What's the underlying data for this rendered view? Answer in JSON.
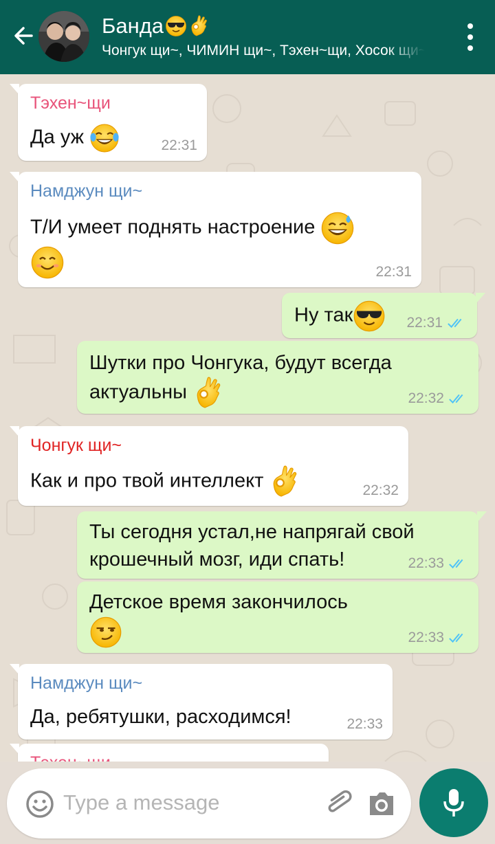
{
  "header": {
    "title": "Банда",
    "subtitle": "Чонгук щи~, ЧИМИН щи~, Тэхен~щи, Хосок щи~, Намджун щи~",
    "bg_color": "#075e54"
  },
  "messages": [
    {
      "id": "m1",
      "direction": "in",
      "sender": "Тэхен~щи",
      "sender_color": "#e8537a",
      "text": "Да уж",
      "emoji": [
        "tears-joy"
      ],
      "time": "22:31"
    },
    {
      "id": "m2",
      "direction": "in",
      "sender": "Намджун щи~",
      "sender_color": "#5b8bbf",
      "text": "Т/И умеет поднять настроение",
      "emoji": [
        "sweat-smile",
        "smiling"
      ],
      "time": "22:31"
    },
    {
      "id": "m3",
      "direction": "out",
      "text": "Ну так",
      "emoji": [
        "sunglasses"
      ],
      "time": "22:31",
      "ticks": "read"
    },
    {
      "id": "m4",
      "direction": "out",
      "text1": "Шутки про Чонгука, будут всегда",
      "text2": "актуальны",
      "emoji": [
        "ok-hand"
      ],
      "time": "22:32",
      "ticks": "read"
    },
    {
      "id": "m5",
      "direction": "in",
      "sender": "Чонгук щи~",
      "sender_color": "#e02424",
      "text": "Как и про твой интеллект",
      "emoji": [
        "ok-hand"
      ],
      "time": "22:32"
    },
    {
      "id": "m6",
      "direction": "out",
      "text1": "Ты сегодня устал,не напрягай свой",
      "text2": "крошечный мозг, иди спать!",
      "time": "22:33",
      "ticks": "read"
    },
    {
      "id": "m7",
      "direction": "out",
      "text": "Детское время закончилось",
      "emoji": [
        "smirk"
      ],
      "time": "22:33",
      "ticks": "read"
    },
    {
      "id": "m8",
      "direction": "in",
      "sender": "Намджун щи~",
      "sender_color": "#5b8bbf",
      "text": "Да, ребятушки, расходимся!",
      "time": "22:33"
    },
    {
      "id": "m9",
      "direction": "in",
      "sender": "Тэхен~щи",
      "sender_color": "#e8537a"
    }
  ],
  "composer": {
    "placeholder": "Type a message",
    "icons": [
      "emoji-icon",
      "attach-icon",
      "camera-icon",
      "mic-icon"
    ]
  },
  "colors": {
    "incoming_bg": "#ffffff",
    "outgoing_bg": "#dcf8c6",
    "read_tick": "#4fc3f7",
    "mic_bg": "#0b7d6f"
  }
}
